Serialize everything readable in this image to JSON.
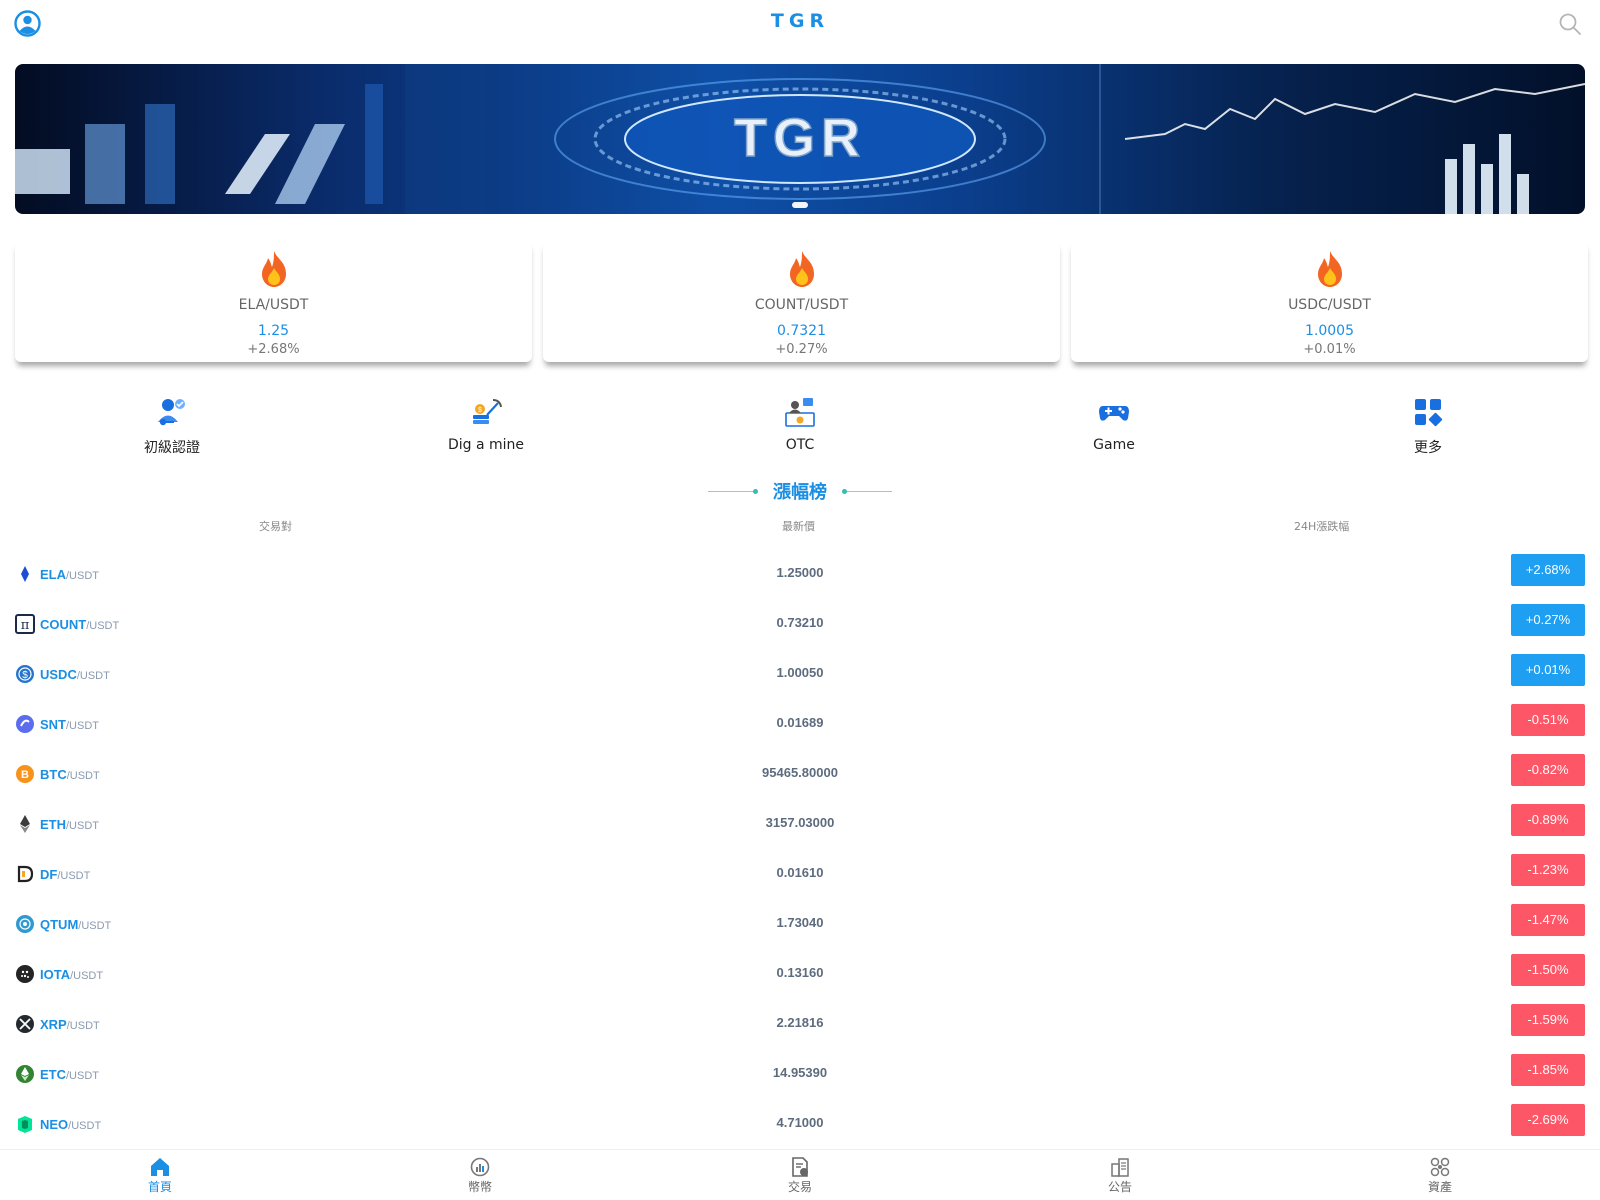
{
  "header": {
    "title": "TGR"
  },
  "banner": {
    "logo_text": "TGR"
  },
  "hot_cards": [
    {
      "pair": "ELA/USDT",
      "price": "1.25",
      "change": "+2.68%"
    },
    {
      "pair": "COUNT/USDT",
      "price": "0.7321",
      "change": "+0.27%"
    },
    {
      "pair": "USDC/USDT",
      "price": "1.0005",
      "change": "+0.01%"
    }
  ],
  "menu": [
    {
      "label": "初級認證",
      "icon": "user-verify-icon"
    },
    {
      "label": "Dig a mine",
      "icon": "mining-icon"
    },
    {
      "label": "OTC",
      "icon": "otc-icon"
    },
    {
      "label": "Game",
      "icon": "gamepad-icon"
    },
    {
      "label": "更多",
      "icon": "grid-more-icon"
    }
  ],
  "gainers": {
    "title": "漲幅榜",
    "columns": {
      "pair": "交易對",
      "price": "最新價",
      "change": "24H漲跌幅"
    },
    "rows": [
      {
        "base": "ELA",
        "quote": "/USDT",
        "price": "1.25000",
        "change": "+2.68%",
        "dir": "up",
        "icon": "ela-icon",
        "color": "#1a4fd6"
      },
      {
        "base": "COUNT",
        "quote": "/USDT",
        "price": "0.73210",
        "change": "+0.27%",
        "dir": "up",
        "icon": "count-icon",
        "color": "#1b2a4a"
      },
      {
        "base": "USDC",
        "quote": "/USDT",
        "price": "1.00050",
        "change": "+0.01%",
        "dir": "up",
        "icon": "usdc-icon",
        "color": "#2775ca"
      },
      {
        "base": "SNT",
        "quote": "/USDT",
        "price": "0.01689",
        "change": "-0.51%",
        "dir": "down",
        "icon": "snt-icon",
        "color": "#5b6dee"
      },
      {
        "base": "BTC",
        "quote": "/USDT",
        "price": "95465.80000",
        "change": "-0.82%",
        "dir": "down",
        "icon": "btc-icon",
        "color": "#f7931a"
      },
      {
        "base": "ETH",
        "quote": "/USDT",
        "price": "3157.03000",
        "change": "-0.89%",
        "dir": "down",
        "icon": "eth-icon",
        "color": "#3c3c3d"
      },
      {
        "base": "DF",
        "quote": "/USDT",
        "price": "0.01610",
        "change": "-1.23%",
        "dir": "down",
        "icon": "df-icon",
        "color": "#222222"
      },
      {
        "base": "QTUM",
        "quote": "/USDT",
        "price": "1.73040",
        "change": "-1.47%",
        "dir": "down",
        "icon": "qtum-icon",
        "color": "#2e9ad0"
      },
      {
        "base": "IOTA",
        "quote": "/USDT",
        "price": "0.13160",
        "change": "-1.50%",
        "dir": "down",
        "icon": "iota-icon",
        "color": "#242424"
      },
      {
        "base": "XRP",
        "quote": "/USDT",
        "price": "2.21816",
        "change": "-1.59%",
        "dir": "down",
        "icon": "xrp-icon",
        "color": "#23292f"
      },
      {
        "base": "ETC",
        "quote": "/USDT",
        "price": "14.95390",
        "change": "-1.85%",
        "dir": "down",
        "icon": "etc-icon",
        "color": "#328332"
      },
      {
        "base": "NEO",
        "quote": "/USDT",
        "price": "4.71000",
        "change": "-2.69%",
        "dir": "down",
        "icon": "neo-icon",
        "color": "#00e599"
      }
    ]
  },
  "tabbar": [
    {
      "label": "首頁",
      "icon": "home-icon",
      "active": true
    },
    {
      "label": "幣幣",
      "icon": "chart-icon",
      "active": false
    },
    {
      "label": "交易",
      "icon": "trade-icon",
      "active": false
    },
    {
      "label": "公告",
      "icon": "announcement-icon",
      "active": false
    },
    {
      "label": "資產",
      "icon": "assets-icon",
      "active": false
    }
  ],
  "colors": {
    "accent": "#1a8fe3",
    "up": "#1e9ff2",
    "down": "#fc5667"
  }
}
